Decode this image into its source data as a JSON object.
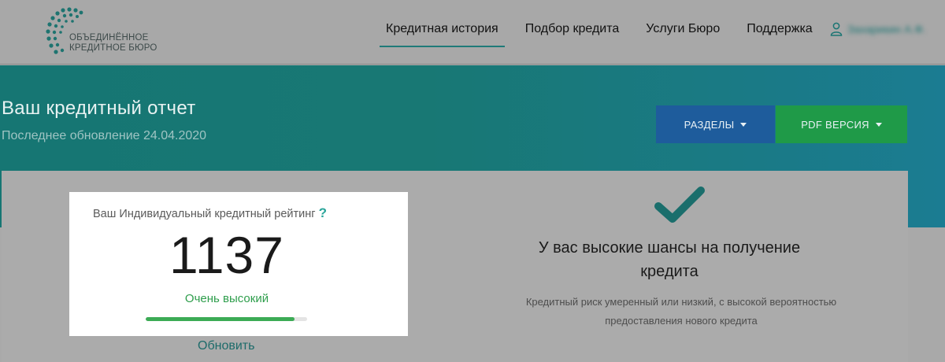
{
  "header": {
    "logo": {
      "line1": "ОБЪЕДИНЁННОЕ",
      "line2": "КРЕДИТНОЕ БЮРО"
    },
    "nav": [
      {
        "label": "Кредитная история",
        "active": true
      },
      {
        "label": "Подбор кредита",
        "active": false
      },
      {
        "label": "Услуги Бюро",
        "active": false
      },
      {
        "label": "Поддержка",
        "active": false
      }
    ],
    "user": {
      "icon": "user-icon",
      "name": "Захарикин А.Ф."
    }
  },
  "banner": {
    "title": "Ваш кредитный отчет",
    "subtitle": "Последнее обновление 24.04.2020",
    "buttons": {
      "sections": "РАЗДЕЛЫ",
      "pdf": "PDF ВЕРСИЯ"
    }
  },
  "score": {
    "label": "Ваш Индивидуальный кредитный рейтинг",
    "help": "?",
    "value": "1137",
    "level": "Очень высокий",
    "progress_fraction": 0.92,
    "refresh": "Обновить"
  },
  "chances": {
    "icon": "checkmark-icon",
    "title": "У вас высокие шансы на получение кредита",
    "text": "Кредитный риск умеренный или низкий, с высокой вероятностью предоставления нового кредита"
  },
  "colors": {
    "accent": "#1a7a78",
    "sections_button": "#1e5c9c",
    "pdf_button": "#1f9a48",
    "score_level": "#2e9e4c"
  }
}
